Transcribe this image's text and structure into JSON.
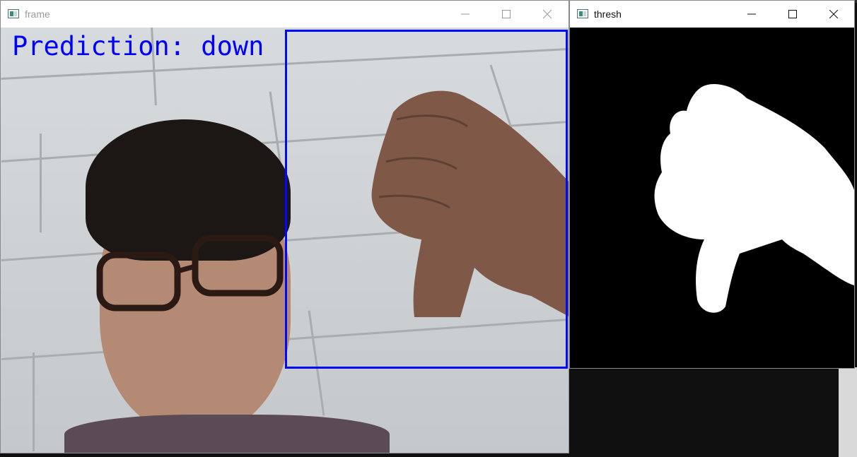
{
  "windows": {
    "frame": {
      "title": "frame",
      "overlay_text": "Prediction: down",
      "title_color": "#9a9a9a"
    },
    "thresh": {
      "title": "thresh",
      "title_color": "#111111"
    }
  },
  "controls": {
    "minimize_icon": "minimize-icon",
    "maximize_icon": "maximize-icon",
    "close_icon": "close-icon"
  },
  "colors": {
    "overlay_text": "#0000ff",
    "roi_box": "#0008ff",
    "mask_foreground": "#ffffff",
    "mask_background": "#000000"
  }
}
